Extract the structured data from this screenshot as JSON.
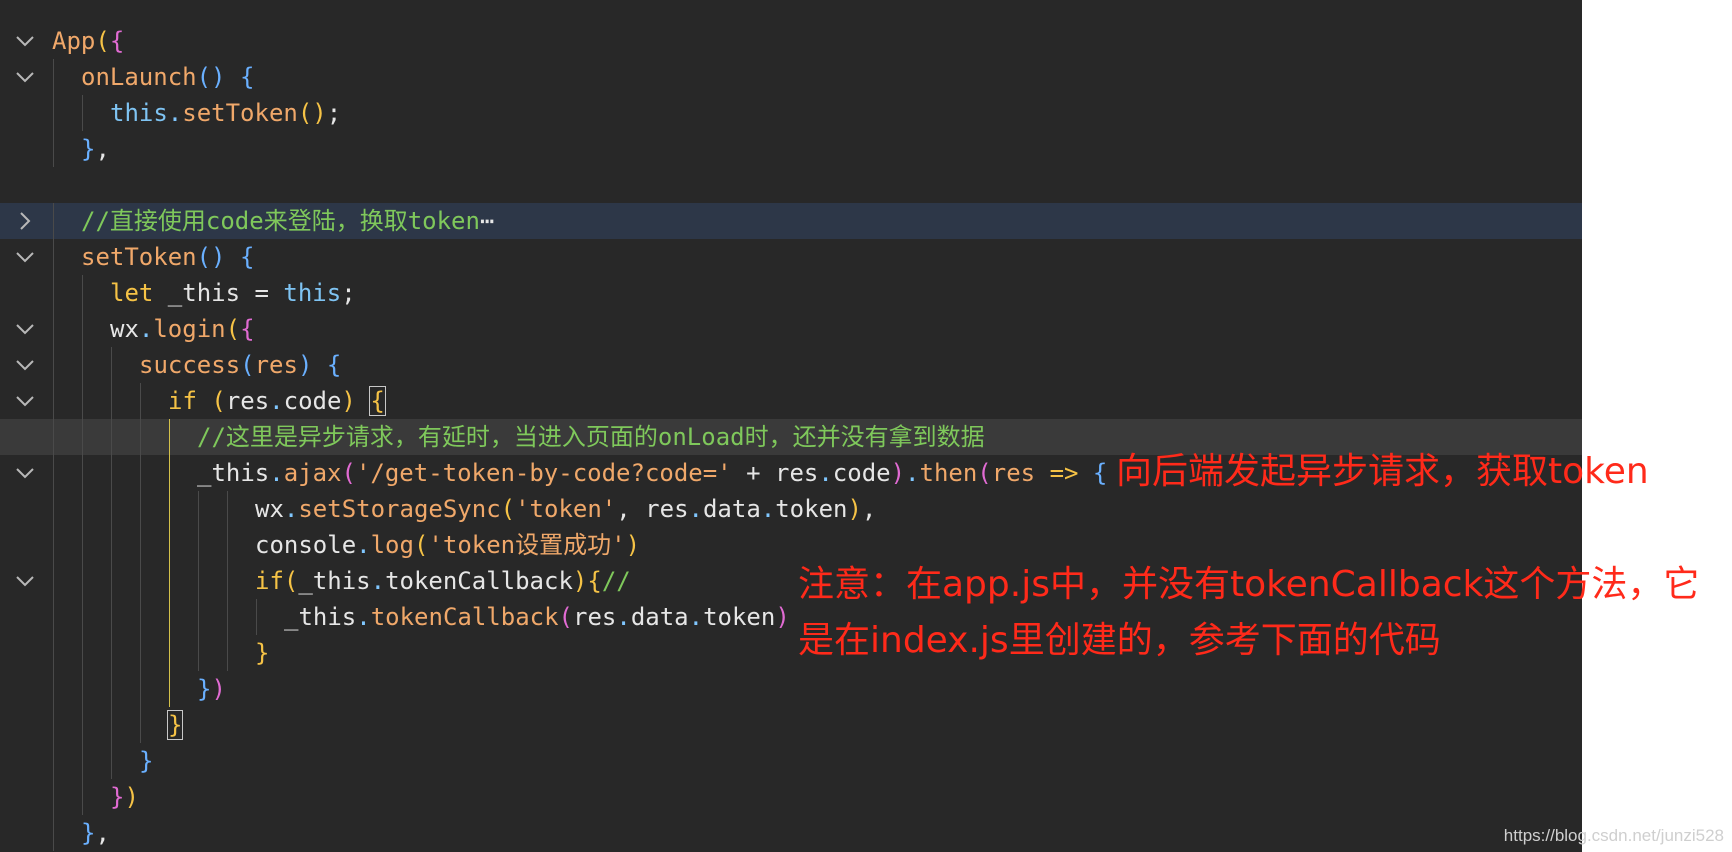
{
  "editor": {
    "lines": [
      {
        "indent": 0,
        "fold": "open",
        "tokens": [
          [
            "fn",
            "App"
          ],
          [
            "br1",
            "("
          ],
          [
            "br2",
            "{"
          ]
        ]
      },
      {
        "indent": 1,
        "fold": "open",
        "tokens": [
          [
            "fn",
            "onLaunch"
          ],
          [
            "br3",
            "()"
          ],
          [
            "pl",
            " "
          ],
          [
            "br3",
            "{"
          ]
        ]
      },
      {
        "indent": 2,
        "fold": "none",
        "tokens": [
          [
            "th",
            "this"
          ],
          [
            "pun",
            "."
          ],
          [
            "fn",
            "setToken"
          ],
          [
            "br1",
            "()"
          ],
          [
            "pl",
            ";"
          ]
        ]
      },
      {
        "indent": 1,
        "fold": "none",
        "tokens": [
          [
            "br3",
            "}"
          ],
          [
            "pl",
            ","
          ]
        ]
      },
      {
        "indent": 0,
        "fold": "none",
        "tokens": []
      },
      {
        "indent": 1,
        "fold": "closed",
        "highlight": "blue",
        "tokens": [
          [
            "cm",
            "//直接使用code来登陆，换取token"
          ],
          [
            "pl",
            "⋯"
          ]
        ]
      },
      {
        "indent": 1,
        "fold": "open",
        "tokens": [
          [
            "fn",
            "setToken"
          ],
          [
            "br3",
            "()"
          ],
          [
            "pl",
            " "
          ],
          [
            "br3",
            "{"
          ]
        ]
      },
      {
        "indent": 2,
        "fold": "none",
        "tokens": [
          [
            "kw",
            "let"
          ],
          [
            "pl",
            " _this = "
          ],
          [
            "th",
            "this"
          ],
          [
            "pl",
            ";"
          ]
        ]
      },
      {
        "indent": 2,
        "fold": "open",
        "tokens": [
          [
            "pl",
            "wx"
          ],
          [
            "pun",
            "."
          ],
          [
            "fn",
            "login"
          ],
          [
            "br1",
            "("
          ],
          [
            "br2",
            "{"
          ]
        ]
      },
      {
        "indent": 3,
        "fold": "open",
        "tokens": [
          [
            "fn",
            "success"
          ],
          [
            "br3",
            "("
          ],
          [
            "par",
            "res"
          ],
          [
            "br3",
            ")"
          ],
          [
            "pl",
            " "
          ],
          [
            "br3",
            "{"
          ]
        ]
      },
      {
        "indent": 4,
        "fold": "open",
        "tokens": [
          [
            "kw",
            "if"
          ],
          [
            "pl",
            " "
          ],
          [
            "br1",
            "("
          ],
          [
            "pl",
            "res"
          ],
          [
            "pun",
            "."
          ],
          [
            "pl",
            "code"
          ],
          [
            "br1",
            ")"
          ],
          [
            "pl",
            " "
          ],
          [
            "box",
            "{"
          ]
        ]
      },
      {
        "indent": 5,
        "fold": "none",
        "highlight": "gray",
        "tokens": [
          [
            "cm",
            "//这里是异步请求，有延时，当进入页面的onLoad时，还并没有拿到数据"
          ]
        ]
      },
      {
        "indent": 5,
        "fold": "open",
        "tokens": [
          [
            "pl",
            "_this"
          ],
          [
            "pun",
            "."
          ],
          [
            "fn",
            "ajax"
          ],
          [
            "br2",
            "("
          ],
          [
            "str",
            "'/get-token-by-code?code='"
          ],
          [
            "pl",
            " + res"
          ],
          [
            "pun",
            "."
          ],
          [
            "pl",
            "code"
          ],
          [
            "br2",
            ")"
          ],
          [
            "pun",
            "."
          ],
          [
            "fn",
            "then"
          ],
          [
            "br2",
            "("
          ],
          [
            "par",
            "res"
          ],
          [
            "pl",
            " "
          ],
          [
            "ar",
            "=>"
          ],
          [
            "pl",
            " "
          ],
          [
            "br3",
            "{"
          ]
        ]
      },
      {
        "indent": 7,
        "fold": "none",
        "tokens": [
          [
            "pl",
            "wx"
          ],
          [
            "pun",
            "."
          ],
          [
            "fn",
            "setStorageSync"
          ],
          [
            "br1",
            "("
          ],
          [
            "str",
            "'token'"
          ],
          [
            "pl",
            ", res"
          ],
          [
            "pun",
            "."
          ],
          [
            "pl",
            "data"
          ],
          [
            "pun",
            "."
          ],
          [
            "pl",
            "token"
          ],
          [
            "br1",
            ")"
          ],
          [
            "pl",
            ","
          ]
        ]
      },
      {
        "indent": 7,
        "fold": "none",
        "tokens": [
          [
            "pl",
            "console"
          ],
          [
            "pun",
            "."
          ],
          [
            "fn",
            "log"
          ],
          [
            "br1",
            "("
          ],
          [
            "str",
            "'token设置成功'"
          ],
          [
            "br1",
            ")"
          ]
        ]
      },
      {
        "indent": 7,
        "fold": "open",
        "tokens": [
          [
            "kw",
            "if"
          ],
          [
            "br1",
            "("
          ],
          [
            "pl",
            "_this"
          ],
          [
            "pun",
            "."
          ],
          [
            "pl",
            "tokenCallback"
          ],
          [
            "br1",
            ")"
          ],
          [
            "br1",
            "{"
          ],
          [
            "cm",
            "//"
          ]
        ]
      },
      {
        "indent": 8,
        "fold": "none",
        "tokens": [
          [
            "pl",
            "_this"
          ],
          [
            "pun",
            "."
          ],
          [
            "fn",
            "tokenCallback"
          ],
          [
            "br2",
            "("
          ],
          [
            "pl",
            "res"
          ],
          [
            "pun",
            "."
          ],
          [
            "pl",
            "data"
          ],
          [
            "pun",
            "."
          ],
          [
            "pl",
            "token"
          ],
          [
            "br2",
            ")"
          ]
        ]
      },
      {
        "indent": 7,
        "fold": "none",
        "tokens": [
          [
            "br1",
            "}"
          ]
        ]
      },
      {
        "indent": 5,
        "fold": "none",
        "tokens": [
          [
            "br3",
            "}"
          ],
          [
            "br2",
            ")"
          ]
        ]
      },
      {
        "indent": 4,
        "fold": "none",
        "tokens": [
          [
            "box",
            "}"
          ]
        ]
      },
      {
        "indent": 3,
        "fold": "none",
        "tokens": [
          [
            "br3",
            "}"
          ]
        ]
      },
      {
        "indent": 2,
        "fold": "none",
        "tokens": [
          [
            "br2",
            "}"
          ],
          [
            "br1",
            ")"
          ]
        ]
      },
      {
        "indent": 1,
        "fold": "none",
        "tokens": [
          [
            "br3",
            "}"
          ],
          [
            "pl",
            ","
          ]
        ]
      }
    ]
  },
  "annotations": {
    "line1": "向后端发起异步请求，获取token",
    "line2": "注意：在app.js中，并没有tokenCallback这个方法，它",
    "line3": "是在index.js里创建的，参考下面的代码"
  },
  "watermark": "https://blog.csdn.net/junzi528",
  "colors": {
    "background": "#282828",
    "annotation": "#ff2a1a",
    "comment": "#7fc85b",
    "function": "#f0a86a",
    "keyword": "#f6c346",
    "this": "#7fc4f3"
  }
}
